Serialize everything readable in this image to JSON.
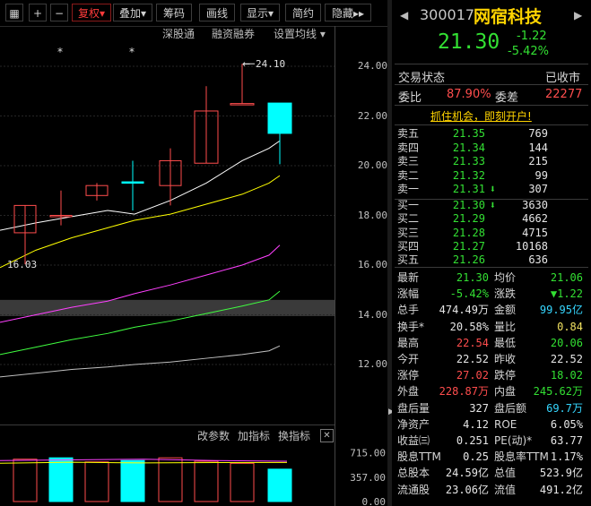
{
  "colors": {
    "up": "#ff4d4d",
    "down": "#33e033",
    "cyan": "#00ffff",
    "ma_white": "#ffffff",
    "ma_yellow": "#ffff00",
    "ma_magenta": "#ff40ff",
    "ma_green": "#40ff40",
    "ma_gray": "#c0c0c0"
  },
  "toolbar": {
    "restore_label": "复权",
    "overlay_label": "叠加",
    "chips_label": "筹码",
    "draw_label": "画线",
    "display_label": "显示",
    "simple_label": "简约",
    "hide_label": "隐藏",
    "sub_links": [
      "深股通",
      "融资融券",
      "设置均线"
    ]
  },
  "chart_data": {
    "type": "candlestick",
    "ylim": [
      11.6,
      24.6
    ],
    "yticks": [
      "24.00",
      "22.00",
      "20.00",
      "18.00",
      "16.00",
      "14.00",
      "12.00"
    ],
    "annotations": {
      "high": "24.10",
      "low": "16.03"
    },
    "candles": [
      {
        "open": 17.3,
        "close": 18.4,
        "high": 18.4,
        "low": 16.03
      },
      {
        "open": 18.0,
        "close": 18.0,
        "high": 19.0,
        "low": 17.6
      },
      {
        "open": 18.8,
        "close": 19.2,
        "high": 19.3,
        "low": 18.6
      },
      {
        "open": 19.35,
        "close": 19.35,
        "high": 20.2,
        "low": 18.2
      },
      {
        "open": 19.2,
        "close": 20.2,
        "high": 20.7,
        "low": 18.4
      },
      {
        "open": 20.1,
        "close": 22.2,
        "high": 23.2,
        "low": 20.1
      },
      {
        "open": 22.5,
        "close": 22.5,
        "high": 24.1,
        "low": 22.5
      },
      {
        "open": 22.52,
        "close": 21.3,
        "high": 22.52,
        "low": 20.06
      }
    ],
    "ma_lines": [
      {
        "color": "#ffffff",
        "y": [
          17.4,
          17.7,
          17.95,
          18.2,
          18.05,
          18.6,
          19.3,
          20.2,
          20.7,
          21.0
        ]
      },
      {
        "color": "#ffff00",
        "y": [
          15.9,
          16.6,
          17.1,
          17.5,
          17.8,
          18.05,
          18.45,
          18.85,
          19.3,
          19.6
        ]
      },
      {
        "color": "#ff40ff",
        "y": [
          13.7,
          14.0,
          14.3,
          14.55,
          14.85,
          15.2,
          15.6,
          16.0,
          16.4,
          16.8
        ]
      },
      {
        "color": "#40ff40",
        "y": [
          12.4,
          12.7,
          13.0,
          13.25,
          13.5,
          13.75,
          14.05,
          14.35,
          14.6,
          14.95
        ]
      },
      {
        "color": "#c0c0c0",
        "y": [
          11.5,
          11.65,
          11.8,
          11.9,
          12.0,
          12.1,
          12.25,
          12.4,
          12.55,
          12.75
        ]
      }
    ],
    "volume": {
      "ylim": [
        0,
        800
      ],
      "yticks": [
        "715.00",
        "357.00",
        "0.00"
      ],
      "values": [
        620,
        640,
        580,
        600,
        640,
        590,
        560,
        474
      ]
    }
  },
  "indicator_toolbar": {
    "change_params": "改参数",
    "add_indicator": "加指标",
    "switch_indicator": "换指标"
  },
  "quote": {
    "code": "300017",
    "name": "网宿科技",
    "price": "21.30",
    "change": "-1.22",
    "pct": "-5.42%",
    "status_label": "交易状态",
    "status": "已收市",
    "wb_label": "委比",
    "wb": "87.90%",
    "wc_label": "委差",
    "wc": "22277",
    "promo": "抓住机会，即刻开户!",
    "asks": [
      {
        "label": "卖五",
        "price": "21.35",
        "vol": "769",
        "arrow": ""
      },
      {
        "label": "卖四",
        "price": "21.34",
        "vol": "144",
        "arrow": ""
      },
      {
        "label": "卖三",
        "price": "21.33",
        "vol": "215",
        "arrow": ""
      },
      {
        "label": "卖二",
        "price": "21.32",
        "vol": "99",
        "arrow": ""
      },
      {
        "label": "卖一",
        "price": "21.31",
        "vol": "307",
        "arrow": "⬇"
      }
    ],
    "bids": [
      {
        "label": "买一",
        "price": "21.30",
        "vol": "3630",
        "arrow": "⬇"
      },
      {
        "label": "买二",
        "price": "21.29",
        "vol": "4662",
        "arrow": ""
      },
      {
        "label": "买三",
        "price": "21.28",
        "vol": "4715",
        "arrow": ""
      },
      {
        "label": "买四",
        "price": "21.27",
        "vol": "10168",
        "arrow": ""
      },
      {
        "label": "买五",
        "price": "21.26",
        "vol": "636",
        "arrow": ""
      }
    ],
    "stats": [
      {
        "l1": "最新",
        "v1": "21.30",
        "c1": "green",
        "l2": "均价",
        "v2": "21.06",
        "c2": "green"
      },
      {
        "l1": "涨幅",
        "v1": "-5.42%",
        "c1": "green",
        "l2": "涨跌",
        "v2": "▼1.22",
        "c2": "green"
      },
      {
        "l1": "总手",
        "v1": "474.49万",
        "c1": "white",
        "l2": "金额",
        "v2": "99.95亿",
        "c2": "cyan"
      },
      {
        "l1": "换手*",
        "v1": "20.58%",
        "c1": "white",
        "l2": "量比",
        "v2": "0.84",
        "c2": "yellow"
      },
      {
        "l1": "最高",
        "v1": "22.54",
        "c1": "red",
        "l2": "最低",
        "v2": "20.06",
        "c2": "green"
      },
      {
        "l1": "今开",
        "v1": "22.52",
        "c1": "white",
        "l2": "昨收",
        "v2": "22.52",
        "c2": "white"
      },
      {
        "l1": "涨停",
        "v1": "27.02",
        "c1": "red",
        "l2": "跌停",
        "v2": "18.02",
        "c2": "green"
      },
      {
        "l1": "外盘",
        "v1": "228.87万",
        "c1": "red",
        "l2": "内盘",
        "v2": "245.62万",
        "c2": "green"
      },
      {
        "l1": "盘后量",
        "v1": "327",
        "c1": "white",
        "l2": "盘后额",
        "v2": "69.7万",
        "c2": "cyan"
      },
      {
        "l1": "净资产",
        "v1": "4.12",
        "c1": "white",
        "l2": "ROE",
        "v2": "6.05%",
        "c2": "white"
      },
      {
        "l1": "收益㈢",
        "v1": "0.251",
        "c1": "white",
        "l2": "PE(动)*",
        "v2": "63.77",
        "c2": "white"
      },
      {
        "l1": "股息TTM",
        "v1": "0.25",
        "c1": "white",
        "l2": "股息率TTM",
        "v2": "1.17%",
        "c2": "white"
      },
      {
        "l1": "总股本",
        "v1": "24.59亿",
        "c1": "white",
        "l2": "总值",
        "v2": "523.9亿",
        "c2": "white"
      },
      {
        "l1": "流通股",
        "v1": "23.06亿",
        "c1": "white",
        "l2": "流值",
        "v2": "491.2亿",
        "c2": "white"
      }
    ]
  }
}
